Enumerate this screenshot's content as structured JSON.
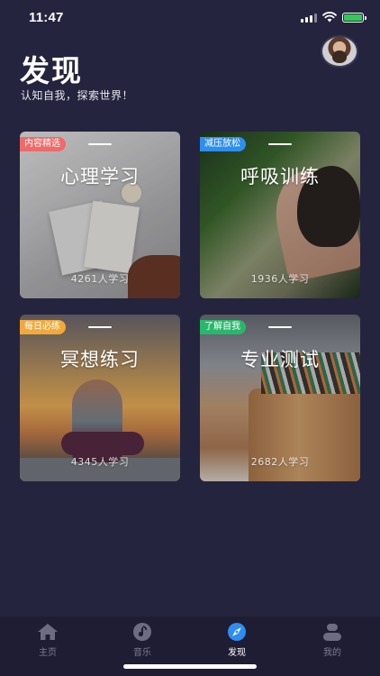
{
  "status_bar": {
    "time": "11:47",
    "icons": [
      "signal-icon",
      "wifi-icon",
      "battery-charging-icon"
    ]
  },
  "header": {
    "title": "发现",
    "subtitle": "认知自我，探索世界！",
    "avatar_icon": "user-avatar"
  },
  "cards": [
    {
      "badge": "内容精选",
      "badge_color": "#f06a6a",
      "title": "心理学习",
      "count": "4261人学习"
    },
    {
      "badge": "减压放松",
      "badge_color": "#2d8ef0",
      "title": "呼吸训练",
      "count": "1936人学习"
    },
    {
      "badge": "每日必练",
      "badge_color": "#f0a93a",
      "title": "冥想练习",
      "count": "4345人学习"
    },
    {
      "badge": "了解自我",
      "badge_color": "#28b86b",
      "title": "专业测试",
      "count": "2682人学习"
    }
  ],
  "tab_bar": {
    "items": [
      {
        "label": "主页",
        "icon": "home-icon"
      },
      {
        "label": "音乐",
        "icon": "music-icon"
      },
      {
        "label": "发现",
        "icon": "compass-icon"
      },
      {
        "label": "我的",
        "icon": "profile-icon"
      }
    ],
    "active_index": 2,
    "active_color": "#2d8ef0",
    "inactive_color": "#6d6c83"
  }
}
